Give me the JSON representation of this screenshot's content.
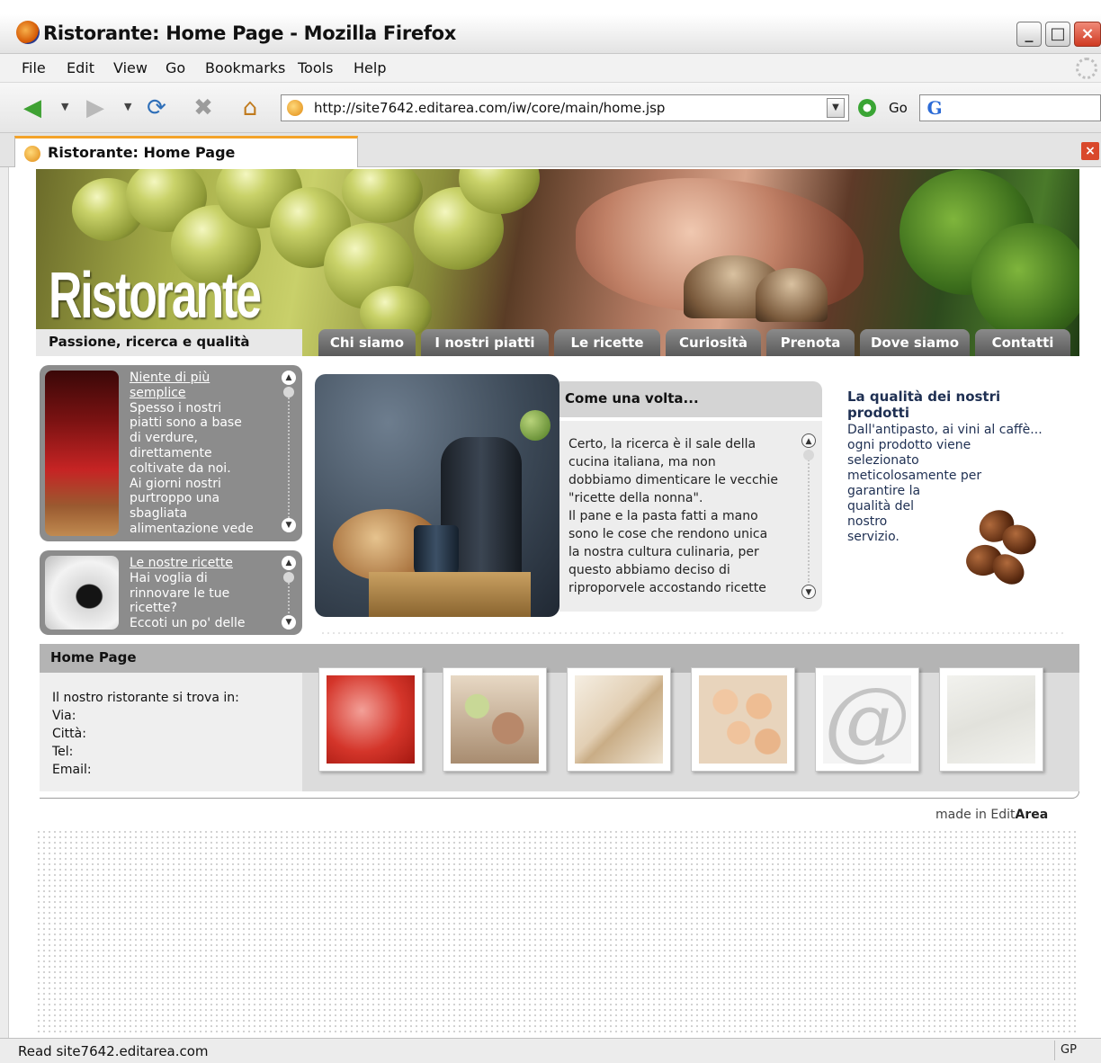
{
  "window": {
    "title": "Ristorante: Home Page - Mozilla Firefox",
    "controls": {
      "minimize": "_",
      "maximize": "□",
      "close": "×"
    }
  },
  "menubar": {
    "items": [
      "File",
      "Edit",
      "View",
      "Go",
      "Bookmarks",
      "Tools",
      "Help"
    ]
  },
  "navbar": {
    "url": "http://site7642.editarea.com/iw/core/main/home.jsp",
    "go_label": "Go",
    "icons": [
      "back-icon",
      "forward-icon",
      "reload-icon",
      "stop-icon",
      "home-icon",
      "google-icon"
    ]
  },
  "tab": {
    "label": "Ristorante: Home Page"
  },
  "status": {
    "text": "Read site7642.editarea.com",
    "indicator": "GP"
  },
  "site": {
    "brand": "Ristorante",
    "tagline": "Passione, ricerca e qualità",
    "nav": [
      "Chi siamo",
      "I nostri piatti",
      "Le ricette",
      "Curiosità",
      "Prenota",
      "Dove siamo",
      "Contatti"
    ]
  },
  "news": [
    {
      "title": "Niente di più semplice",
      "lines": [
        "Spesso i nostri",
        "piatti sono a base",
        "di verdure,",
        "direttamente",
        "coltivate da noi.",
        "Ai giorni nostri",
        "purtroppo una",
        "sbagliata",
        "alimentazione vede"
      ]
    },
    {
      "title": "Le nostre ricette",
      "lines": [
        "Hai voglia di",
        "rinnovare le tue",
        "ricette?",
        "Eccoti un po' delle"
      ]
    }
  ],
  "article": {
    "title": "Come una volta...",
    "lines": [
      "Certo, la ricerca è il sale della",
      "cucina italiana, ma non",
      "dobbiamo dimenticare le vecchie",
      "\"ricette della nonna\".",
      "Il pane e la pasta fatti a mano",
      "sono le cose che rendono unica",
      "la nostra cultura culinaria, per",
      "questo abbiamo deciso di",
      "riproporvele accostando ricette"
    ]
  },
  "quality": {
    "title_lines": [
      "La qualità dei nostri",
      "prodotti"
    ],
    "lines": [
      "Dall'antipasto, ai vini al caffè...",
      "ogni prodotto viene",
      "selezionato",
      "meticolosamente per",
      "garantire la",
      "qualità del",
      "nostro",
      "servizio."
    ]
  },
  "home_section": {
    "title": "Home Page",
    "lines": [
      "Il nostro ristorante si trova in:",
      "Via:",
      "Città:",
      "Tel:",
      "Email:"
    ]
  },
  "credit": {
    "prefix": "made in Edit",
    "bold": "Area"
  },
  "colors": {
    "tab_accent": "#f3a32a",
    "nav_tab": "#6a6a6a",
    "quality_text": "#1e2f52",
    "panel_gray": "#8c8c8c"
  }
}
